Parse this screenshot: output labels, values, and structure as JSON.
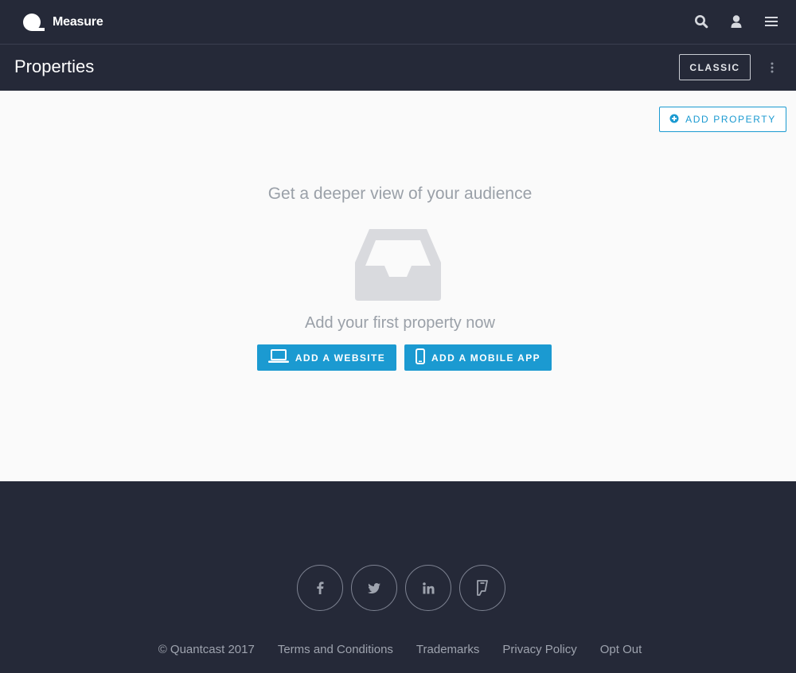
{
  "brand": {
    "name": "Measure"
  },
  "header": {
    "icons": [
      "search-icon",
      "user-icon",
      "menu-icon"
    ]
  },
  "title_bar": {
    "title": "Properties",
    "classic_label": "CLASSIC"
  },
  "main": {
    "add_property_label": "ADD PROPERTY",
    "headline": "Get a deeper view of your audience",
    "subline": "Add your first property now",
    "add_website_label": "ADD A WEBSITE",
    "add_mobile_app_label": "ADD A MOBILE APP"
  },
  "footer": {
    "socials": [
      "facebook-icon",
      "twitter-icon",
      "linkedin-icon",
      "foursquare-icon"
    ],
    "copyright": "© Quantcast 2017",
    "links": [
      "Terms and Conditions",
      "Trademarks",
      "Privacy Policy",
      "Opt Out"
    ]
  },
  "colors": {
    "background_dark": "#252938",
    "accent": "#1b9ad1",
    "content_bg": "#fafafa",
    "muted_text": "#9aa0a8"
  }
}
